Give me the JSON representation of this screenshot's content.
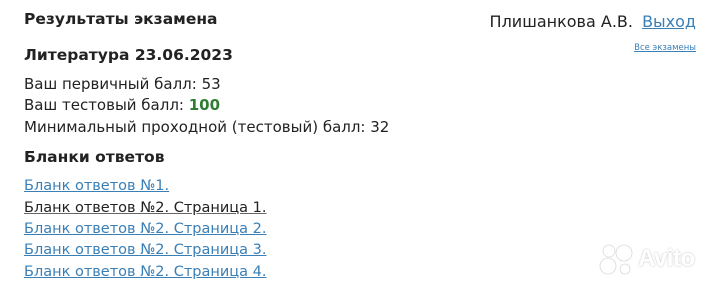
{
  "header": {
    "title": "Результаты экзамена",
    "user_name": "Плишанкова А.В.",
    "logout_label": "Выход",
    "all_exams_label": "Все экзамены"
  },
  "exam": {
    "title": "Литература 23.06.2023",
    "primary_score_label": "Ваш первичный балл: ",
    "primary_score_value": "53",
    "test_score_label": "Ваш тестовый балл: ",
    "test_score_value": "100",
    "min_score_label": "Минимальный проходной (тестовый) балл: ",
    "min_score_value": "32"
  },
  "answer_forms": {
    "title": "Бланки ответов",
    "links": [
      "Бланк ответов №1.",
      "Бланк ответов №2. Страница 1.",
      "Бланк ответов №2. Страница 2.",
      "Бланк ответов №2. Страница 3.",
      "Бланк ответов №2. Страница 4."
    ]
  },
  "watermark": {
    "text": "Avito"
  },
  "colors": {
    "link": "#3a7fb6",
    "score_highlight": "#2e7d32",
    "text": "#222222"
  }
}
